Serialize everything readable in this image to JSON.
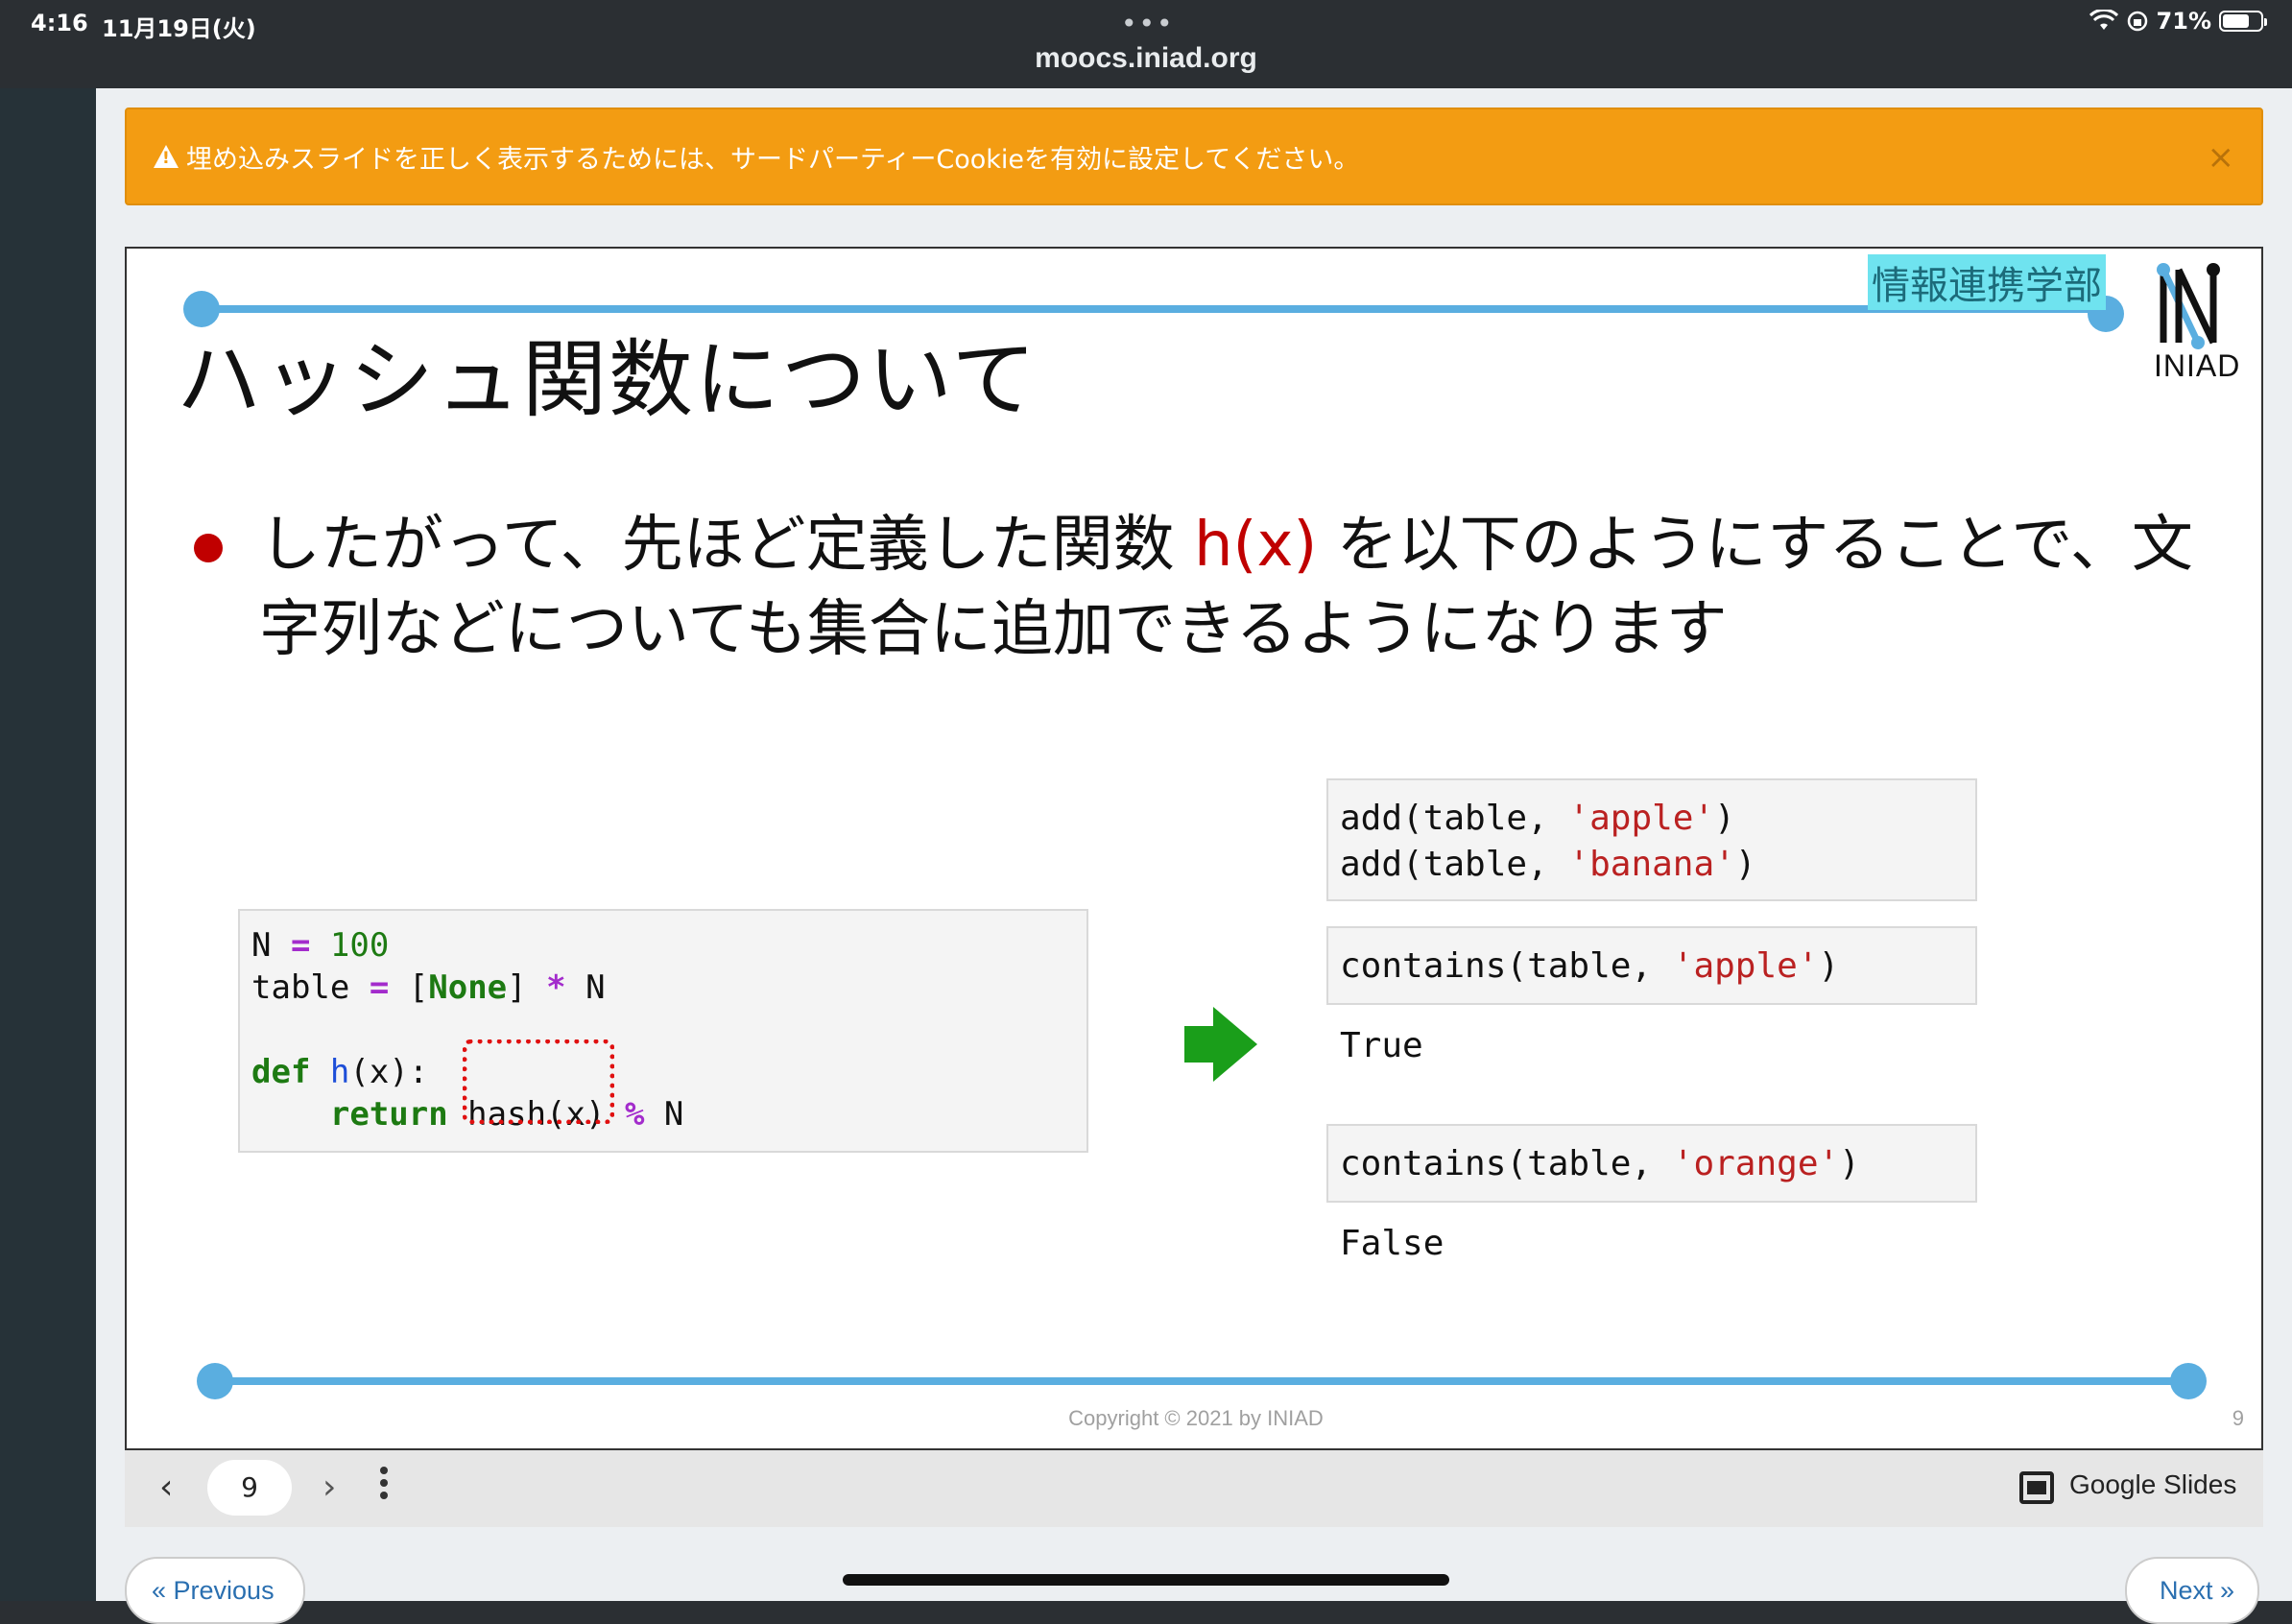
{
  "status_bar": {
    "time": "4:16",
    "date": "11月19日(火)",
    "dots": "•••",
    "battery": "71%",
    "battery_level": 0.71
  },
  "browser": {
    "url": "moocs.iniad.org"
  },
  "alert": {
    "message": "埋め込みスライドを正しく表示するためには、サードパーティーCookieを有効に設定してください。",
    "close": "×",
    "color": "#f39c12"
  },
  "slide": {
    "dept": "情報連携学部",
    "logo_text": "INIAD",
    "title": "ハッシュ関数について",
    "bullet_prefix": "したがって、先ほど定義した関数 ",
    "bullet_hx": "h(x)",
    "bullet_suffix": "  を以下のようにすることで、文字列などについても集合に追加できるようになります",
    "code_left": {
      "line1_a": "N ",
      "line1_op": "=",
      "line1_num": " 100",
      "line2_a": "table ",
      "line2_op": "=",
      "line2_b": " [",
      "line2_kw": "None",
      "line2_c": "] ",
      "line2_op2": "*",
      "line2_d": " N",
      "line4_kw": "def",
      "line4_fn": " h",
      "line4_b": "(x):",
      "line5_kw": "    return",
      "line5_b": " hash(x) ",
      "line5_op": "%",
      "line5_c": " N"
    },
    "code_right1": {
      "l1_a": "add(table, ",
      "l1_str": "'apple'",
      "l1_b": ")",
      "l2_a": "add(table, ",
      "l2_str": "'banana'",
      "l2_b": ")"
    },
    "code_right2": {
      "a": "contains(table, ",
      "str": "'apple'",
      "b": ")"
    },
    "output1": "True",
    "code_right3": {
      "a": "contains(table, ",
      "str": "'orange'",
      "b": ")"
    },
    "output2": "False",
    "copyright": "Copyright © 2021 by INIAD",
    "slide_number": "9",
    "accent_color": "#5aaee0",
    "arrow_color": "#1a9e1a"
  },
  "controls": {
    "prev": "‹",
    "page": "9",
    "next": "›",
    "brand": "Google Slides"
  },
  "nav": {
    "previous": "« Previous",
    "next": "Next »"
  }
}
